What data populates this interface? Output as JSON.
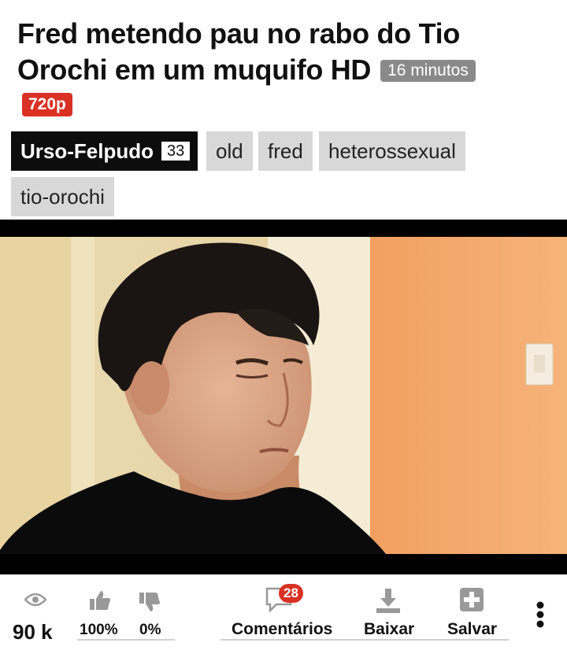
{
  "video": {
    "title": "Fred metendo pau no rabo do Tio Orochi em um muquifo HD",
    "duration": "16 minutos",
    "quality": "720p"
  },
  "channel": {
    "name": "Urso-Felpudo",
    "count": "33"
  },
  "tags": [
    "old",
    "fred",
    "heterossexual",
    "tio-orochi"
  ],
  "stats": {
    "views": "90 k",
    "like_percent": "100%",
    "dislike_percent": "0%",
    "comments_count": "28",
    "comments_label": "Comentários",
    "download_label": "Baixar",
    "save_label": "Salvar"
  },
  "icons": {
    "views": "eye-icon",
    "like": "thumbs-up-icon",
    "dislike": "thumbs-down-icon",
    "comments": "speech-bubble-icon",
    "download": "download-icon",
    "save": "plus-square-icon",
    "more": "vertical-dots-icon"
  },
  "colors": {
    "accent": "#d93124",
    "tag_bg": "#d8d8d8",
    "channel_bg": "#0d0d0d",
    "duration_bg": "#8a8a8a"
  }
}
